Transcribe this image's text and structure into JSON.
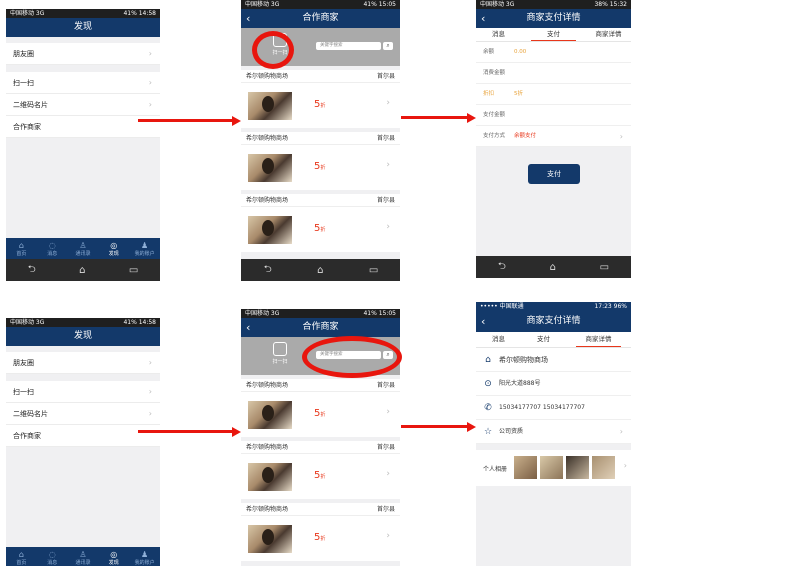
{
  "status": {
    "carrier": "中国移动 3G",
    "carrier_ios": "••••• 中国联通",
    "battery_a": "41%",
    "battery_b": "38%",
    "time_a": "14:58",
    "time_b": "15:05",
    "time_c": "15:32",
    "time_d": "17:23",
    "battery_d": "96%"
  },
  "discover": {
    "title": "发现",
    "items": [
      {
        "label": "朋友圈"
      },
      {
        "label": "扫一扫"
      },
      {
        "label": "二维码名片"
      },
      {
        "label": "合作商家"
      }
    ],
    "tabs": [
      {
        "label": "首页",
        "icon": "home-icon"
      },
      {
        "label": "消息",
        "icon": "chat-icon"
      },
      {
        "label": "通讯录",
        "icon": "contacts-icon"
      },
      {
        "label": "发现",
        "icon": "discover-icon"
      },
      {
        "label": "我的账户",
        "icon": "account-icon"
      }
    ]
  },
  "partners": {
    "title": "合作商家",
    "scan_label": "扫一扫",
    "search_placeholder": "关键字搜索",
    "merchants": [
      {
        "name": "希尔顿购物商场",
        "location": "首尔县",
        "discount": "5",
        "discount_unit": "折"
      },
      {
        "name": "希尔顿购物商场",
        "location": "首尔县",
        "discount": "5",
        "discount_unit": "折"
      },
      {
        "name": "希尔顿购物商场",
        "location": "首尔县",
        "discount": "5",
        "discount_unit": "折"
      }
    ]
  },
  "payment": {
    "title": "商家支付详情",
    "tabs": [
      "消息",
      "支付",
      "商家详情"
    ],
    "rows": [
      {
        "label": "余额",
        "value": "0.00"
      },
      {
        "label": "消费金额",
        "value": ""
      },
      {
        "label": "折扣",
        "value": "5折"
      },
      {
        "label": "支付金额",
        "value": ""
      },
      {
        "label": "支付方式",
        "value": "余额支付"
      }
    ],
    "pay_button": "支付"
  },
  "details": {
    "name": "希尔顿购物商场",
    "address": "阳光大道888号",
    "phones": "15034177707  15034177707",
    "qualification": "公司资质",
    "album": "个人相册"
  },
  "colors": {
    "brand": "#13396a",
    "accent": "#e8371b",
    "annotation": "#e8160e"
  }
}
